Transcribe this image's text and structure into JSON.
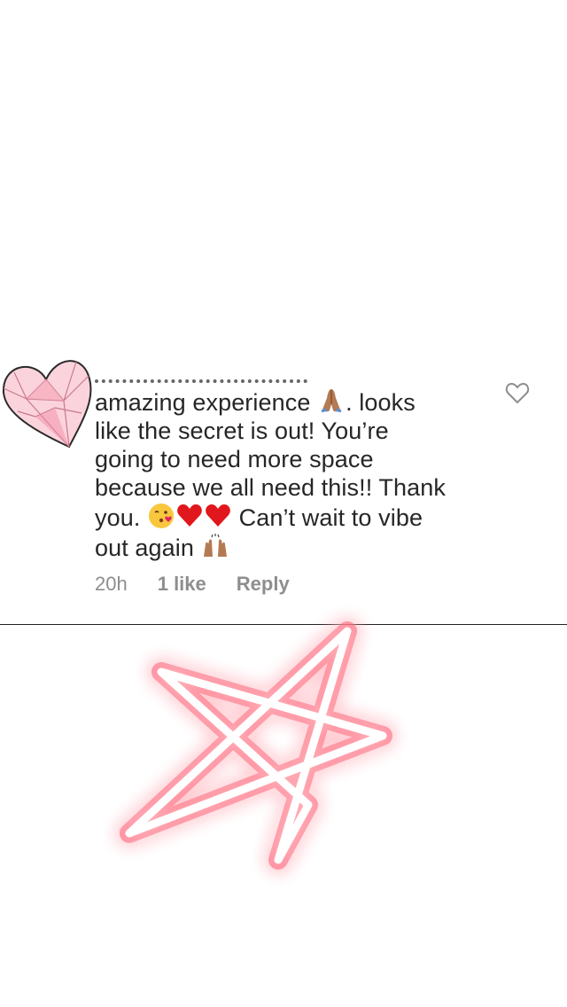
{
  "comment": {
    "lines": [
      "amazing experience",
      ". looks",
      "like the secret is out! You’re",
      "going to need more space",
      "because we all need this!! Thank",
      "you.",
      "Can’t wait to vibe",
      "out again"
    ],
    "timestamp": "20h",
    "likes": "1 like",
    "reply_label": "Reply"
  },
  "icons": {
    "sticker": "pink-gem-heart-sticker",
    "like": "heart-outline-icon",
    "emoji_1": "folded-hands-emoji",
    "emoji_2": "kissing-face-emoji",
    "emoji_3": "red-heart-emoji",
    "emoji_4": "raised-hands-emoji",
    "overlay": "neon-star-sticker"
  },
  "colors": {
    "text": "#262626",
    "meta": "#8e8e8e",
    "neon": "#ff4d6d"
  }
}
